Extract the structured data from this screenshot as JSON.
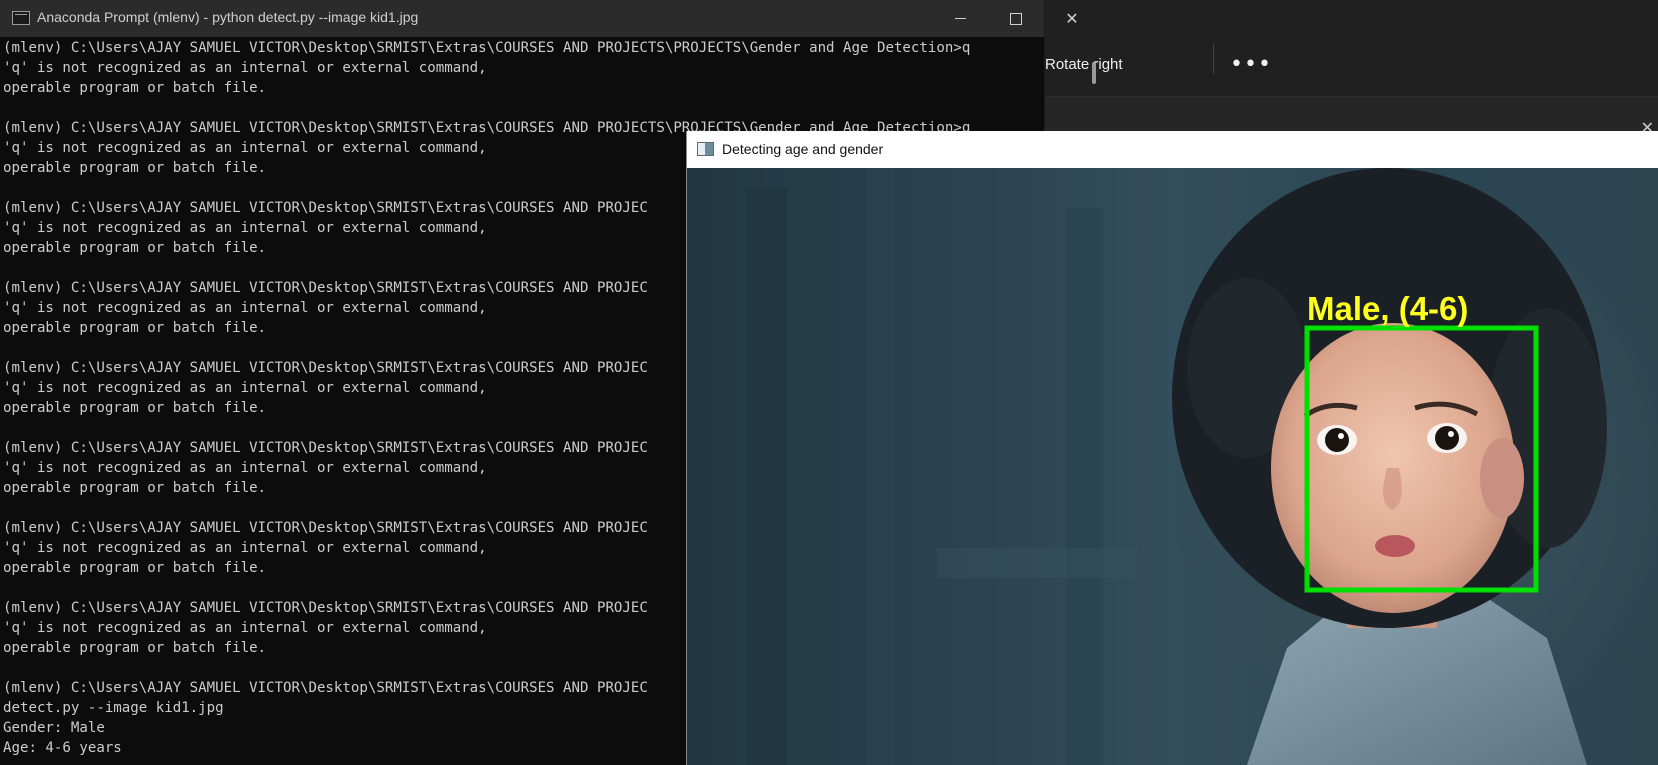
{
  "viewer": {
    "rotate_right_label": "Rotate right",
    "more_label": "•••",
    "close_label": "✕"
  },
  "console": {
    "title": "Anaconda Prompt (mlenv) - python  detect.py --image kid1.jpg",
    "controls": {
      "minimize": "",
      "maximize": "",
      "close": "✕"
    },
    "lines": [
      "(mlenv) C:\\Users\\AJAY SAMUEL VICTOR\\Desktop\\SRMIST\\Extras\\COURSES AND PROJECTS\\PROJECTS\\Gender and Age Detection>q",
      "'q' is not recognized as an internal or external command,",
      "operable program or batch file.",
      "",
      "(mlenv) C:\\Users\\AJAY SAMUEL VICTOR\\Desktop\\SRMIST\\Extras\\COURSES AND PROJECTS\\PROJECTS\\Gender and Age Detection>q",
      "'q' is not recognized as an internal or external command,",
      "operable program or batch file.",
      "",
      "(mlenv) C:\\Users\\AJAY SAMUEL VICTOR\\Desktop\\SRMIST\\Extras\\COURSES AND PROJEC",
      "'q' is not recognized as an internal or external command,",
      "operable program or batch file.",
      "",
      "(mlenv) C:\\Users\\AJAY SAMUEL VICTOR\\Desktop\\SRMIST\\Extras\\COURSES AND PROJEC",
      "'q' is not recognized as an internal or external command,",
      "operable program or batch file.",
      "",
      "(mlenv) C:\\Users\\AJAY SAMUEL VICTOR\\Desktop\\SRMIST\\Extras\\COURSES AND PROJEC",
      "'q' is not recognized as an internal or external command,",
      "operable program or batch file.",
      "",
      "(mlenv) C:\\Users\\AJAY SAMUEL VICTOR\\Desktop\\SRMIST\\Extras\\COURSES AND PROJEC",
      "'q' is not recognized as an internal or external command,",
      "operable program or batch file.",
      "",
      "(mlenv) C:\\Users\\AJAY SAMUEL VICTOR\\Desktop\\SRMIST\\Extras\\COURSES AND PROJEC",
      "'q' is not recognized as an internal or external command,",
      "operable program or batch file.",
      "",
      "(mlenv) C:\\Users\\AJAY SAMUEL VICTOR\\Desktop\\SRMIST\\Extras\\COURSES AND PROJEC",
      "'q' is not recognized as an internal or external command,",
      "operable program or batch file.",
      "",
      "(mlenv) C:\\Users\\AJAY SAMUEL VICTOR\\Desktop\\SRMIST\\Extras\\COURSES AND PROJEC",
      "detect.py --image kid1.jpg",
      "Gender: Male",
      "Age: 4-6 years"
    ]
  },
  "cv_window": {
    "title": "Detecting age and gender",
    "detection_label": "Male, (4-6)",
    "box_color": "#00e000",
    "label_color": "#ffff20"
  }
}
